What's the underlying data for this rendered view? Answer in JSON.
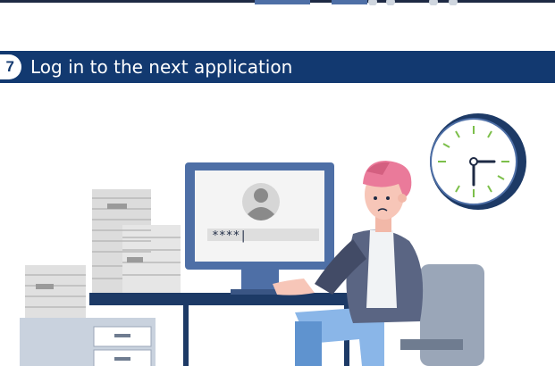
{
  "header": {
    "step_number": "7",
    "title": "Log in to the next application"
  },
  "illustration": {
    "password_mask": "****|",
    "colors": {
      "banner": "#123970",
      "monitor": "#4e6fa6",
      "desk": "#1d3a66",
      "hair": "#ea7a9a",
      "jacket": "#5a6583",
      "chair": "#9aa6b8",
      "paper": "#dcdcdc"
    },
    "icons": [
      "wall-clock-icon",
      "user-avatar-icon",
      "paper-stack-icon",
      "desk-drawer-icon"
    ]
  }
}
